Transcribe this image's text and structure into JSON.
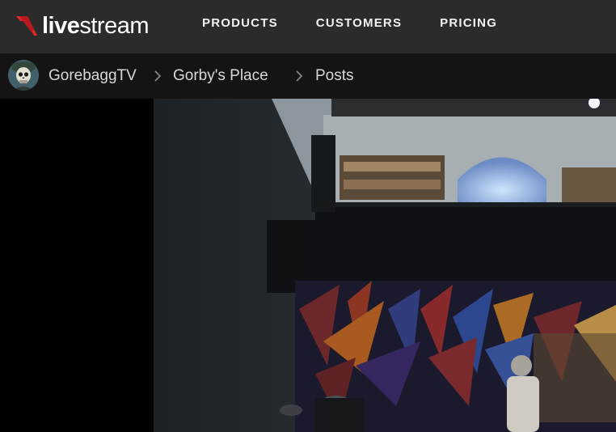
{
  "brand": {
    "logo_bold": "live",
    "logo_light": "stream",
    "accent_color": "#e2262c"
  },
  "nav": {
    "items": [
      "PRODUCTS",
      "CUSTOMERS",
      "PRICING"
    ]
  },
  "breadcrumb": {
    "channel": "GorebaggTV",
    "event": "Gorby's Place",
    "section": "Posts"
  },
  "icons": {
    "avatar": "skull-avatar-icon",
    "separator": "chevron-right-icon"
  }
}
